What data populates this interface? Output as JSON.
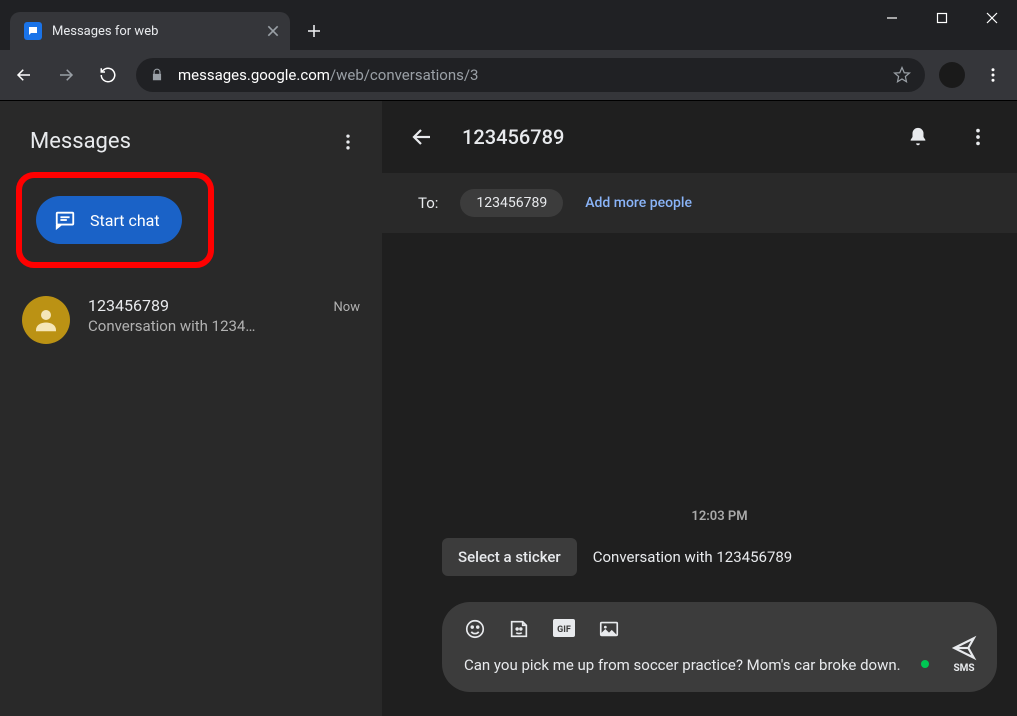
{
  "window": {
    "tab_title": "Messages for web"
  },
  "browser": {
    "url_host": "messages.google.com",
    "url_path": "/web/conversations/3"
  },
  "sidebar": {
    "title": "Messages",
    "start_chat": "Start chat",
    "conversations": [
      {
        "name": "123456789",
        "preview": "Conversation with 1234…",
        "time": "Now"
      }
    ]
  },
  "main": {
    "header_title": "123456789",
    "to_label": "To:",
    "recipient_chip": "123456789",
    "add_people": "Add more people",
    "timestamp": "12:03 PM",
    "sticker_button": "Select a sticker",
    "system_msg": "Conversation with 123456789",
    "composer_text": "Can you pick me up from soccer practice? Mom's car broke down.",
    "send_label": "SMS"
  }
}
